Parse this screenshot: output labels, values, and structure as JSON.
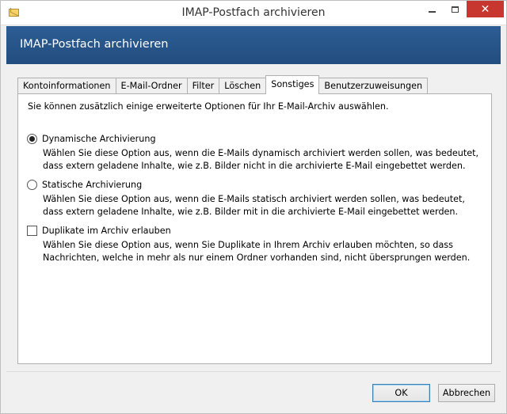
{
  "window": {
    "title": "IMAP-Postfach archivieren",
    "close_symbol": "✕"
  },
  "header": {
    "title": "IMAP-Postfach archivieren"
  },
  "tabs": [
    {
      "label": "Kontoinformationen"
    },
    {
      "label": "E-Mail-Ordner"
    },
    {
      "label": "Filter"
    },
    {
      "label": "Löschen"
    },
    {
      "label": "Sonstiges",
      "active": true
    },
    {
      "label": "Benutzerzuweisungen"
    }
  ],
  "panel": {
    "intro": "Sie können zusätzlich einige erweiterte Optionen für Ihr E-Mail-Archiv auswählen.",
    "options": [
      {
        "label": "Dynamische Archivierung",
        "description": "Wählen Sie diese Option aus, wenn die E-Mails dynamisch archiviert werden sollen, was bedeutet, dass extern geladene Inhalte, wie z.B. Bilder nicht in die archivierte E-Mail eingebettet werden.",
        "selected": true
      },
      {
        "label": "Statische Archivierung",
        "description": "Wählen Sie diese Option aus, wenn die E-Mails statisch archiviert werden sollen, was bedeutet, dass extern geladene Inhalte, wie z.B. Bilder mit in die archivierte E-Mail eingebettet werden.",
        "selected": false
      },
      {
        "label": "Duplikate im Archiv erlauben",
        "description": "Wählen Sie diese Option aus, wenn Sie Duplikate in Ihrem Archiv erlauben möchten, so dass Nachrichten, welche in mehr als nur einem Ordner vorhanden sind, nicht übersprungen werden.",
        "checked": false
      }
    ]
  },
  "footer": {
    "ok_label": "OK",
    "cancel_label": "Abbrechen"
  },
  "colors": {
    "header_band": "#2c5d94",
    "close_button": "#c7372f"
  }
}
